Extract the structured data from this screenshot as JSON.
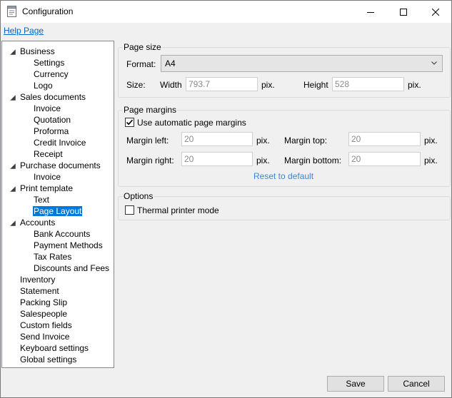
{
  "window": {
    "title": "Configuration"
  },
  "icons": {
    "app": "document-settings-icon",
    "minimize": "minimize-icon",
    "maximize": "maximize-icon",
    "close": "close-icon",
    "dropdown": "chevron-down-icon",
    "check": "checkmark-icon"
  },
  "colors": {
    "selection": "#0078d7",
    "link": "#0066cc",
    "reset_link": "#3b86d8"
  },
  "help_link": "Help Page",
  "tree": [
    {
      "label": "Business",
      "level": 0,
      "expanded": true
    },
    {
      "label": "Settings",
      "level": 1
    },
    {
      "label": "Currency",
      "level": 1
    },
    {
      "label": "Logo",
      "level": 1
    },
    {
      "label": "Sales documents",
      "level": 0,
      "expanded": true
    },
    {
      "label": "Invoice",
      "level": 1
    },
    {
      "label": "Quotation",
      "level": 1
    },
    {
      "label": "Proforma",
      "level": 1
    },
    {
      "label": "Credit Invoice",
      "level": 1
    },
    {
      "label": "Receipt",
      "level": 1
    },
    {
      "label": "Purchase documents",
      "level": 0,
      "expanded": true
    },
    {
      "label": "Invoice",
      "level": 1
    },
    {
      "label": "Print template",
      "level": 0,
      "expanded": true
    },
    {
      "label": "Text",
      "level": 1
    },
    {
      "label": "Page Layout",
      "level": 1,
      "selected": true
    },
    {
      "label": "Accounts",
      "level": 0,
      "expanded": true
    },
    {
      "label": "Bank Accounts",
      "level": 1
    },
    {
      "label": "Payment Methods",
      "level": 1
    },
    {
      "label": "Tax Rates",
      "level": 1
    },
    {
      "label": "Discounts and Fees",
      "level": 1
    },
    {
      "label": "Inventory",
      "level": 0
    },
    {
      "label": "Statement",
      "level": 0
    },
    {
      "label": "Packing Slip",
      "level": 0
    },
    {
      "label": "Salespeople",
      "level": 0
    },
    {
      "label": "Custom fields",
      "level": 0
    },
    {
      "label": "Send Invoice",
      "level": 0
    },
    {
      "label": "Keyboard settings",
      "level": 0
    },
    {
      "label": "Global settings",
      "level": 0
    }
  ],
  "page_size": {
    "title": "Page size",
    "format_label": "Format:",
    "format_value": "A4",
    "size_label": "Size:",
    "width_label": "Width",
    "width_value": "793.7",
    "width_unit": "pix.",
    "height_label": "Height",
    "height_value": "528",
    "height_unit": "pix."
  },
  "page_margins": {
    "title": "Page margins",
    "auto_label": "Use automatic page margins",
    "auto_checked": true,
    "left_label": "Margin left:",
    "left_value": "20",
    "left_unit": "pix.",
    "top_label": "Margin top:",
    "top_value": "20",
    "top_unit": "pix.",
    "right_label": "Margin right:",
    "right_value": "20",
    "right_unit": "pix.",
    "bottom_label": "Margin bottom:",
    "bottom_value": "20",
    "bottom_unit": "pix.",
    "reset_label": "Reset to default"
  },
  "options": {
    "title": "Options",
    "thermal_label": "Thermal printer mode",
    "thermal_checked": false
  },
  "buttons": {
    "save": "Save",
    "cancel": "Cancel"
  }
}
